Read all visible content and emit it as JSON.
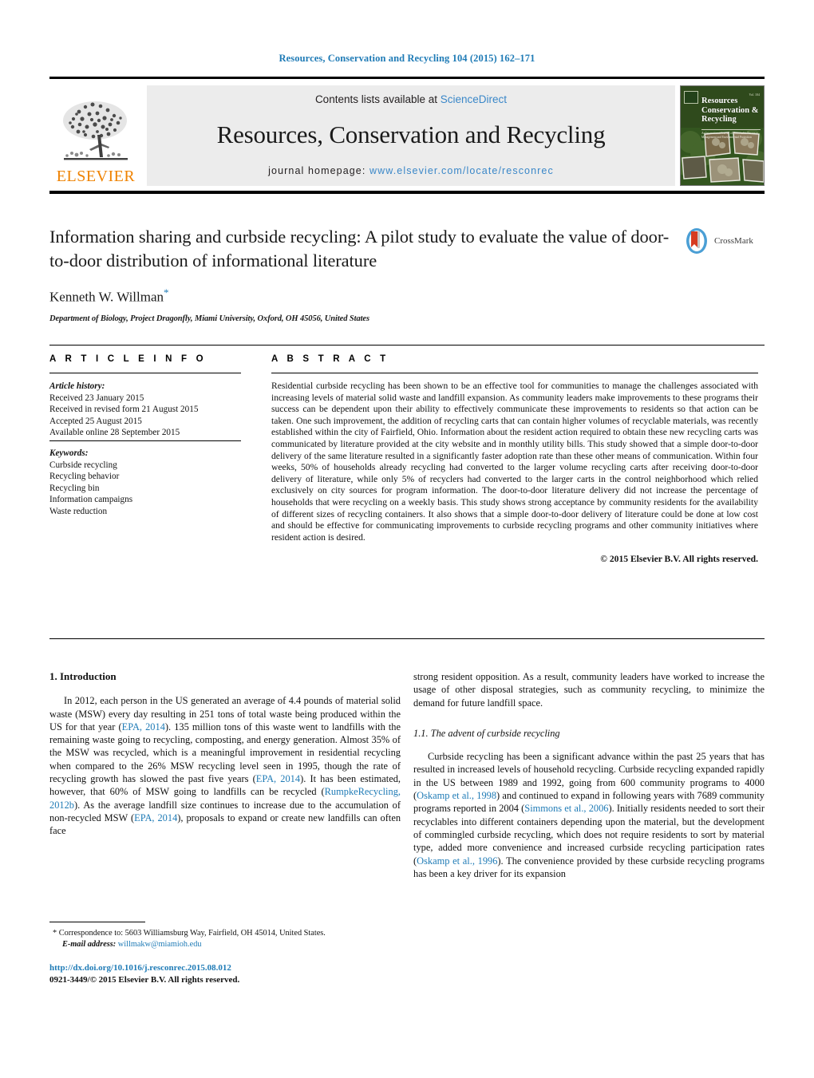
{
  "running_head": "Resources, Conservation and Recycling 104 (2015) 162–171",
  "masthead": {
    "publisher_logo_label": "ELSEVIER",
    "contents_prefix": "Contents lists available at ",
    "contents_link": "ScienceDirect",
    "journal_title": "Resources, Conservation and Recycling",
    "homepage_prefix": "journal homepage: ",
    "homepage_url": "www.elsevier.com/locate/resconrec",
    "cover": {
      "title_line1": "Resources",
      "title_line2": "Conservation &",
      "title_line3": "Recycling",
      "subtitle": "An International Journal of Sustainable Resource Management and Environmental Protection"
    }
  },
  "article": {
    "title": "Information sharing and curbside recycling: A pilot study to evaluate the value of door-to-door distribution of informational literature",
    "author": "Kenneth W. Willman",
    "corresponding_mark": "*",
    "affiliation": "Department of Biology, Project Dragonfly, Miami University, Oxford, OH 45056, United States",
    "crossmark_label": "CrossMark"
  },
  "sections": {
    "article_info_heading": "A R T I C L E   I N F O",
    "abstract_heading": "A B S T R A C T"
  },
  "article_info": {
    "history_label": "Article history:",
    "history": [
      "Received 23 January 2015",
      "Received in revised form 21 August 2015",
      "Accepted 25 August 2015",
      "Available online 28 September 2015"
    ],
    "keywords_label": "Keywords:",
    "keywords": [
      "Curbside recycling",
      "Recycling behavior",
      "Recycling bin",
      "Information campaigns",
      "Waste reduction"
    ]
  },
  "abstract": {
    "text": "Residential curbside recycling has been shown to be an effective tool for communities to manage the challenges associated with increasing levels of material solid waste and landfill expansion. As community leaders make improvements to these programs their success can be dependent upon their ability to effectively communicate these improvements to residents so that action can be taken. One such improvement, the addition of recycling carts that can contain higher volumes of recyclable materials, was recently established within the city of Fairfield, Ohio. Information about the resident action required to obtain these new recycling carts was communicated by literature provided at the city website and in monthly utility bills. This study showed that a simple door-to-door delivery of the same literature resulted in a significantly faster adoption rate than these other means of communication. Within four weeks, 50% of households already recycling had converted to the larger volume recycling carts after receiving door-to-door delivery of literature, while only 5% of recyclers had converted to the larger carts in the control neighborhood which relied exclusively on city sources for program information. The door-to-door literature delivery did not increase the percentage of households that were recycling on a weekly basis. This study shows strong acceptance by community residents for the availability of different sizes of recycling containers. It also shows that a simple door-to-door delivery of literature could be done at low cost and should be effective for communicating improvements to curbside recycling programs and other community initiatives where resident action is desired.",
    "copyright": "© 2015 Elsevier B.V. All rights reserved."
  },
  "body": {
    "intro_heading": "1.  Introduction",
    "intro_p1_a": "In 2012, each person in the US generated an average of 4.4 pounds of material solid waste (MSW) every day resulting in 251 tons of total waste being produced within the US for that year (",
    "intro_cite1": "EPA, 2014",
    "intro_p1_b": "). 135 million tons of this waste went to landfills with the remaining waste going to recycling, composting, and energy generation. Almost 35% of the MSW was recycled, which is a meaningful improvement in residential recycling when compared to the 26% MSW recycling level seen in 1995, though the rate of recycling growth has slowed the past five years (",
    "intro_cite2": "EPA, 2014",
    "intro_p1_c": "). It has been estimated, however, that 60% of MSW going to landfills can be recycled (",
    "intro_cite3": "RumpkeRecycling, 2012b",
    "intro_p1_d": "). As the average landfill size continues to increase due to the accumulation of non-recycled MSW (",
    "intro_cite4": "EPA, 2014",
    "intro_p1_e": "), proposals to expand or create new landfills can often face",
    "right_continuation": "strong resident opposition. As a result, community leaders have worked to increase the usage of other disposal strategies, such as community recycling, to minimize the demand for future landfill space.",
    "subsec_heading": "1.1.  The advent of curbside recycling",
    "sub_p1_a": "Curbside recycling has been a significant advance within the past 25 years that has resulted in increased levels of household recycling. Curbside recycling expanded rapidly in the US between 1989 and 1992, going from 600 community programs to 4000 (",
    "sub_cite1": "Oskamp et al., 1998",
    "sub_p1_b": ") and continued to expand in following years with 7689 community programs reported in 2004 (",
    "sub_cite2": "Simmons et al., 2006",
    "sub_p1_c": "). Initially residents needed to sort their recyclables into different containers depending upon the material, but the development of commingled curbside recycling, which does not require residents to sort by material type, added more convenience and increased curbside recycling participation rates (",
    "sub_cite3": "Oskamp et al., 1996",
    "sub_p1_d": "). The convenience provided by these curbside recycling programs has been a key driver for its expansion"
  },
  "footnote": {
    "marker": "*",
    "correspondence": "Correspondence to: 5603 Williamsburg Way, Fairfield, OH 45014, United States.",
    "email_label": "E-mail address:",
    "email": "willmakw@miamioh.edu"
  },
  "footer": {
    "doi": "http://dx.doi.org/10.1016/j.resconrec.2015.08.012",
    "issn_line": "0921-3449/© 2015 Elsevier B.V. All rights reserved."
  },
  "colors": {
    "link_blue": "#1f7bb6",
    "sciencedirect_blue": "#3a87c8",
    "elsevier_orange": "#ef8200"
  }
}
